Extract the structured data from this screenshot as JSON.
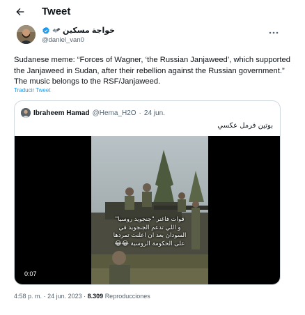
{
  "header": {
    "title": "Tweet"
  },
  "author": {
    "name": "خواجة مسكين",
    "handle": "@daniel_van0"
  },
  "tweet": {
    "text": "Sudanese meme: “Forces of Wagner, ‘the Russian Janjaweed’, which supported the Janjaweed in Sudan, after their rebellion against the Russian government.” The music belongs to the RSF/Janjaweed.",
    "translate_label": "Traducir Tweet"
  },
  "quote": {
    "name": "Ibraheem Hamad",
    "handle": "@Hema_H2O",
    "separator": "·",
    "date": "24 jun.",
    "text": "بوتين فرمل عكسي",
    "video": {
      "time": "0:07",
      "caption_lines": [
        "قوات فاغنر \"جنجويد روسيا\"",
        "و اللي تدعم الجنجويد في",
        "السودان بعد ان اعلنت تمردها",
        "على الحكومة الروسية 😂😂"
      ]
    }
  },
  "meta": {
    "time": "4:58 p. m.",
    "separator": "·",
    "date": "24 jun. 2023",
    "views": "8.309",
    "views_label": "Reproducciones"
  },
  "colors": {
    "accent": "#1d9bf0",
    "text": "#0f1419",
    "muted": "#536471",
    "border": "#cfd9de"
  },
  "icons": {
    "back": "arrow-left-icon",
    "badge": "satellite-emoji-icon",
    "verified": "verified-badge-icon",
    "more": "more-horizontal-icon"
  }
}
